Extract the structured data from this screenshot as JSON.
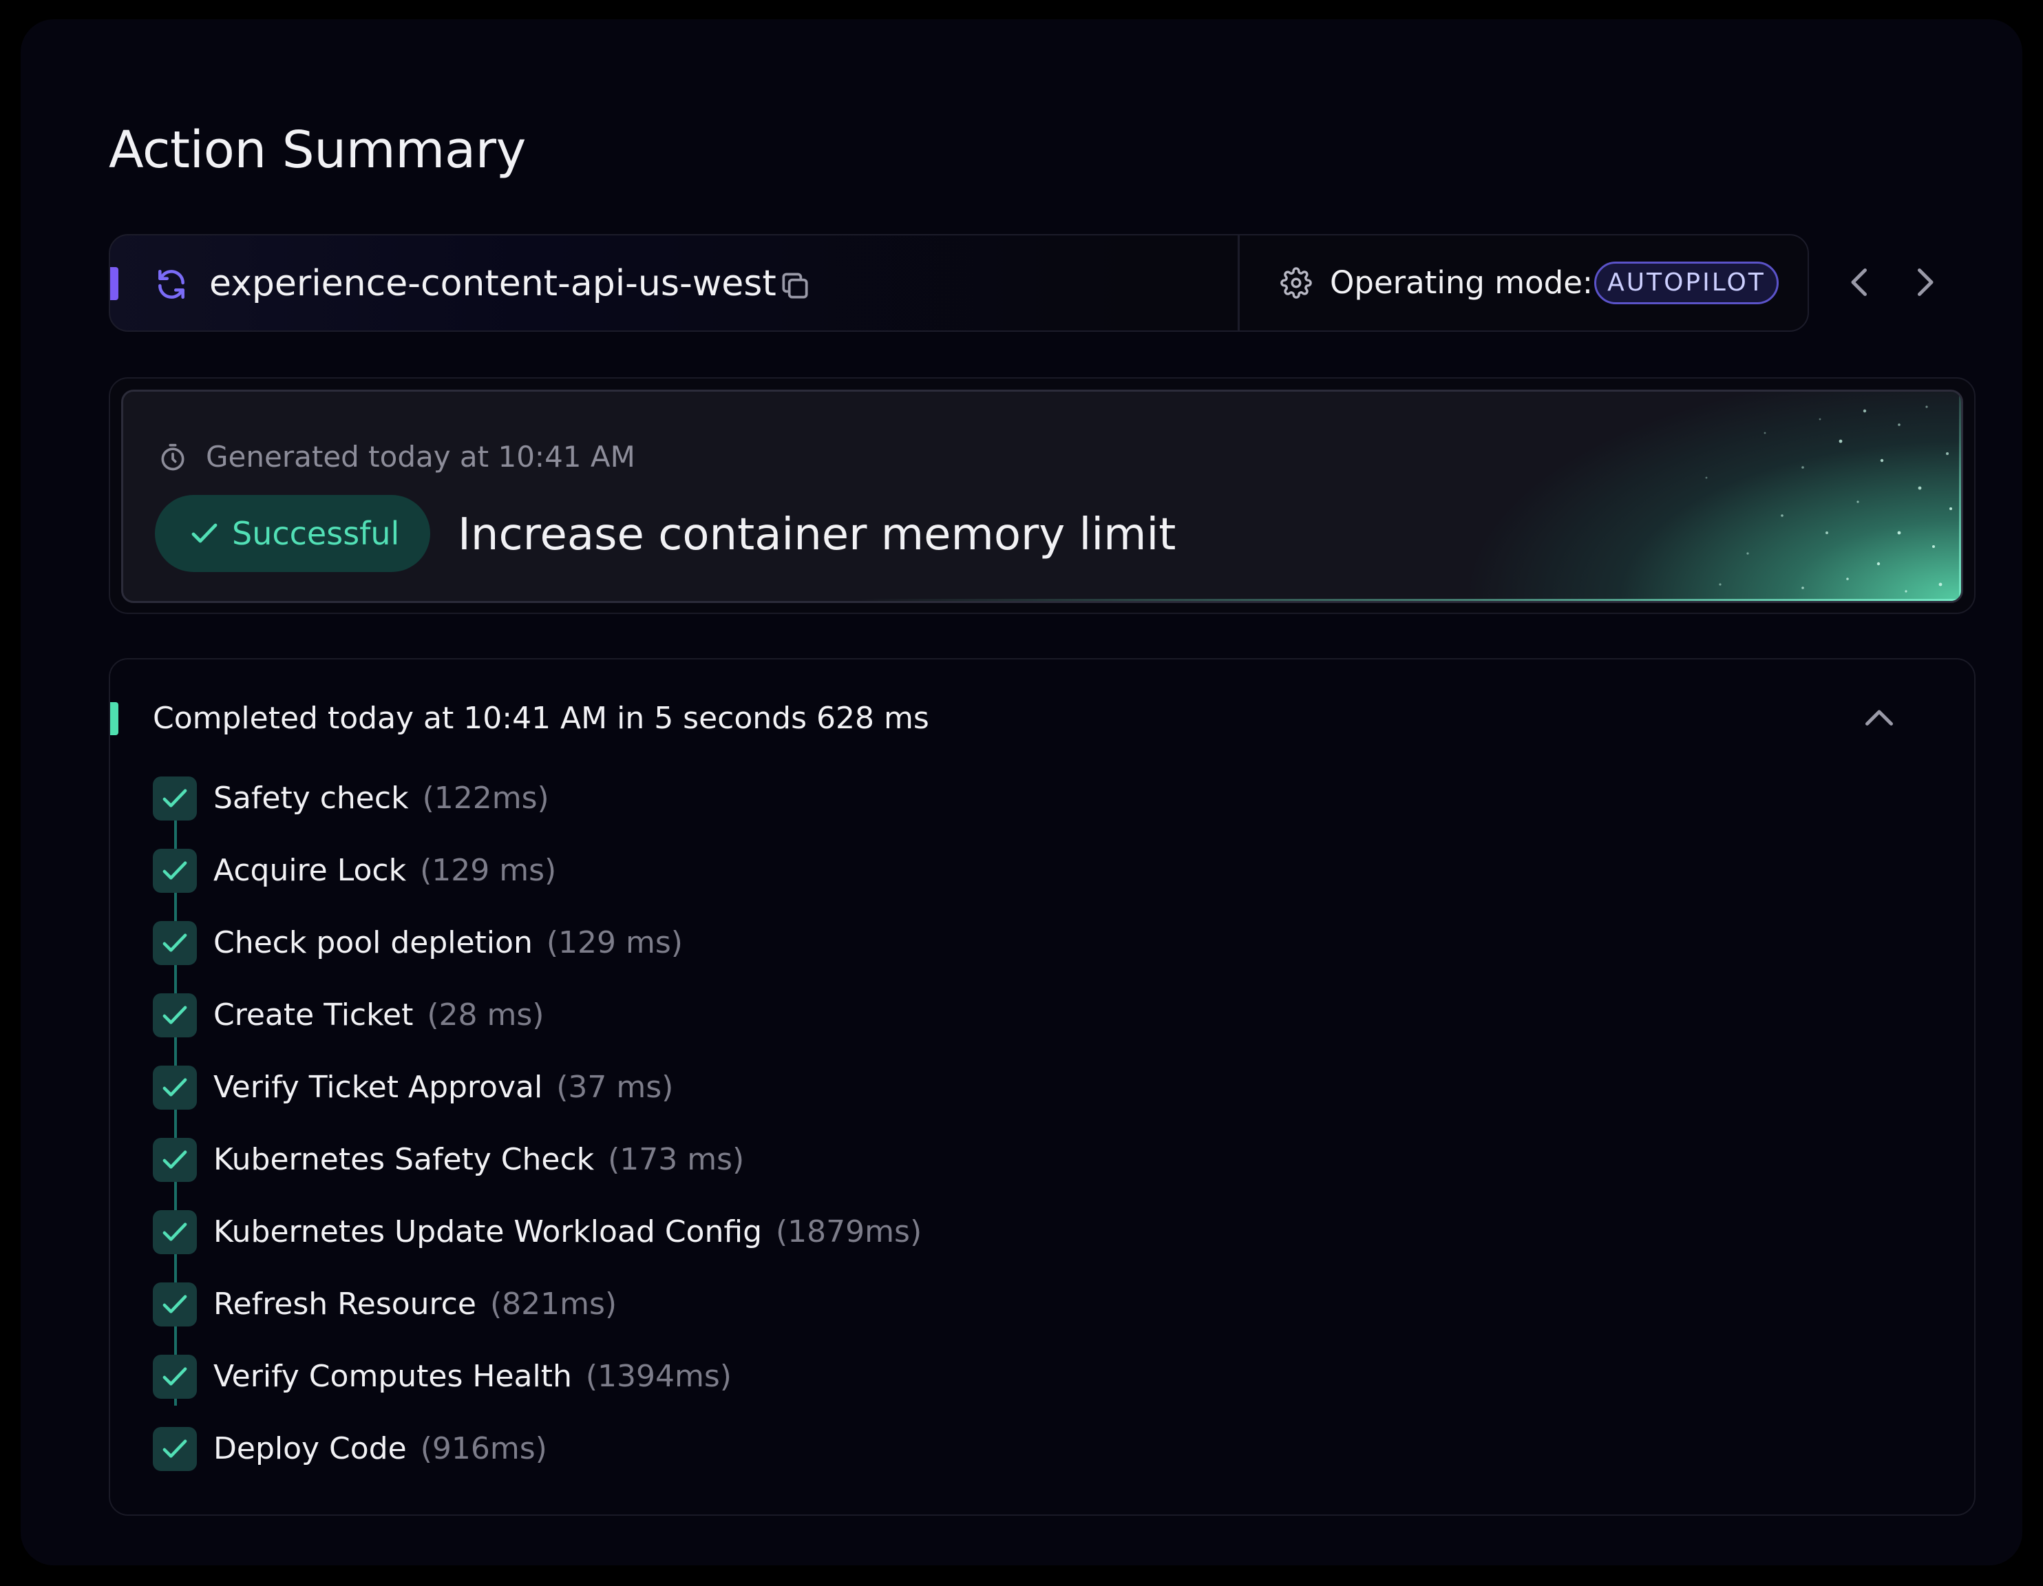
{
  "page": {
    "title": "Action Summary"
  },
  "header": {
    "service_name": "experience-content-api-us-west",
    "operating_mode_label": "Operating mode:",
    "operating_mode_value": "AUTOPILOT",
    "icons": {
      "service": "sync-icon",
      "copy": "copy-icon",
      "mode": "gear-icon",
      "prev": "chevron-left-icon",
      "next": "chevron-right-icon"
    }
  },
  "summary": {
    "generated_text": "Generated today at 10:41 AM",
    "status": "Successful",
    "action_title": "Increase container memory limit",
    "icons": {
      "generated": "timer-icon",
      "status": "check-icon"
    }
  },
  "steps": {
    "completed_text": "Completed today at 10:41 AM in 5 seconds 628 ms",
    "items": [
      {
        "name": "Safety check",
        "duration": "(122ms)"
      },
      {
        "name": "Acquire Lock",
        "duration": "(129 ms)"
      },
      {
        "name": "Check pool depletion",
        "duration": "(129 ms)"
      },
      {
        "name": "Create Ticket",
        "duration": "(28 ms)"
      },
      {
        "name": "Verify Ticket Approval",
        "duration": "(37 ms)"
      },
      {
        "name": "Kubernetes Safety Check",
        "duration": "(173 ms)"
      },
      {
        "name": "Kubernetes Update Workload Config",
        "duration": "(1879ms)"
      },
      {
        "name": "Refresh Resource",
        "duration": "(821ms)"
      },
      {
        "name": "Verify Computes Health",
        "duration": "(1394ms)"
      },
      {
        "name": "Deploy Code",
        "duration": "(916ms)"
      }
    ]
  },
  "colors": {
    "background": "#05050f",
    "accent_purple": "#7b5cf5",
    "accent_green": "#4fe0b0",
    "success_text": "#52e0b6",
    "success_bg": "#123c39",
    "badge_border": "#5b53c9",
    "muted_text": "#7d7d8a"
  }
}
